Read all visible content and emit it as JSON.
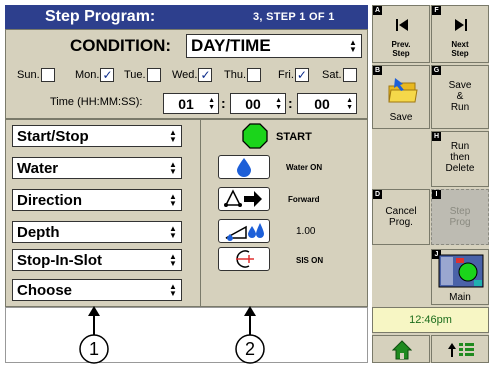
{
  "header": {
    "title": "Step Program:",
    "step_info": "3, STEP  1  OF  1"
  },
  "condition": {
    "label": "CONDITION:",
    "value": "DAY/TIME",
    "days": [
      {
        "label": "Sun.",
        "checked": false
      },
      {
        "label": "Mon.",
        "checked": true
      },
      {
        "label": "Tue.",
        "checked": false
      },
      {
        "label": "Wed.",
        "checked": true
      },
      {
        "label": "Thu.",
        "checked": false
      },
      {
        "label": "Fri.",
        "checked": true
      },
      {
        "label": "Sat.",
        "checked": false
      }
    ],
    "time_label": "Time (HH:MM:SS):",
    "hours": "01",
    "minutes": "00",
    "seconds": "00"
  },
  "actions": [
    {
      "label": "Start/Stop",
      "status": "START",
      "icon": "start-circle-icon"
    },
    {
      "label": "Water",
      "status": "Water ON",
      "icon": "water-drop-icon"
    },
    {
      "label": "Direction",
      "status": "Forward",
      "icon": "direction-forward-icon"
    },
    {
      "label": "Depth",
      "status": "1.00",
      "icon": "depth-icon"
    },
    {
      "label": "Stop-In-Slot",
      "status": "SIS ON",
      "icon": "stop-in-slot-icon"
    },
    {
      "label": "Choose",
      "status": "",
      "icon": ""
    }
  ],
  "callouts": {
    "one": "1",
    "two": "2"
  },
  "buttons": {
    "a_tag": "A",
    "prev": "Prev.\nStep",
    "f_tag": "F",
    "next": "Next\nStep",
    "b_tag": "B",
    "save": "Save",
    "g_tag": "G",
    "save_run": "Save\n&\nRun",
    "h_tag": "H",
    "run_delete": "Run\nthen\nDelete",
    "d_tag": "D",
    "cancel": "Cancel\nProg.",
    "i_tag": "I",
    "step_prog": "Step\nProg",
    "j_tag": "J",
    "main": "Main"
  },
  "clock": "12:46pm",
  "colors": {
    "header": "#2d3f8d",
    "panel": "#d6d1bd",
    "clock_text": "#1c6d1c",
    "start_green": "#1bd41b",
    "water_blue": "#1d5fd8"
  }
}
